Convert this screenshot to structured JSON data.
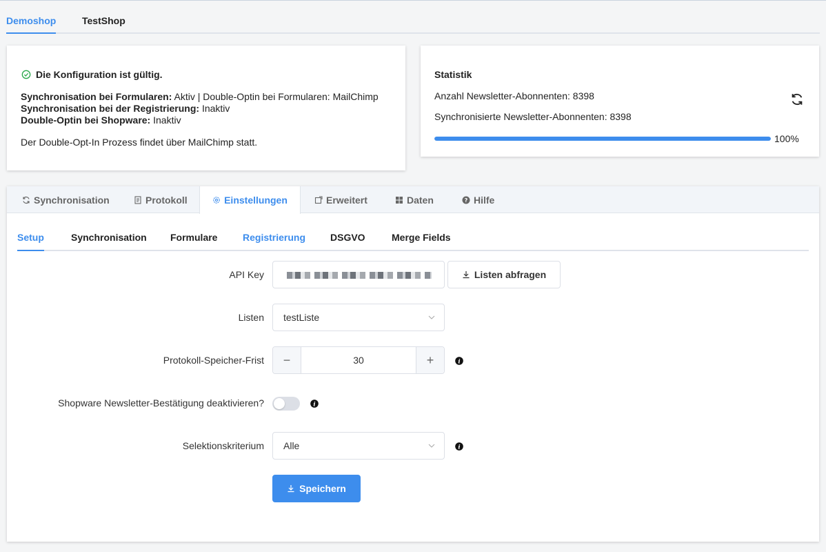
{
  "shop_tabs": [
    {
      "label": "Demoshop",
      "active": true
    },
    {
      "label": "TestShop",
      "active": false
    }
  ],
  "config": {
    "valid_text": "Die Konfiguration ist gültig.",
    "form_sync_label": "Synchronisation bei Formularen:",
    "form_sync_value": "Aktiv | Double-Optin bei Formularen: MailChimp",
    "reg_sync_label": "Synchronisation bei der Registrierung:",
    "reg_sync_value": "Inaktiv",
    "doi_label": "Double-Optin bei Shopware:",
    "doi_value": "Inaktiv",
    "note": "Der Double-Opt-In Prozess findet über MailChimp statt."
  },
  "stats": {
    "title": "Statistik",
    "subscribers": "Anzahl Newsletter-Abonnenten: 8398",
    "synced": "Synchronisierte Newsletter-Abonnenten: 8398",
    "progress_percent": 100,
    "progress_text": "100%"
  },
  "main_tabs": [
    {
      "label": "Synchronisation",
      "icon": "sync-icon"
    },
    {
      "label": "Protokoll",
      "icon": "document-icon"
    },
    {
      "label": "Einstellungen",
      "icon": "gear-icon",
      "active": true
    },
    {
      "label": "Erweitert",
      "icon": "external-icon"
    },
    {
      "label": "Daten",
      "icon": "grid-icon"
    },
    {
      "label": "Hilfe",
      "icon": "question-icon"
    }
  ],
  "sub_tabs": [
    {
      "label": "Setup",
      "active": true
    },
    {
      "label": "Synchronisation"
    },
    {
      "label": "Formulare"
    },
    {
      "label": "Registrierung"
    },
    {
      "label": "DSGVO"
    },
    {
      "label": "Merge Fields"
    }
  ],
  "form": {
    "api_key_label": "API Key",
    "fetch_lists_button": "Listen abfragen",
    "lists_label": "Listen",
    "lists_value": "testListe",
    "log_retention_label": "Protokoll-Speicher-Frist",
    "log_retention_value": "30",
    "disable_confirmation_label": "Shopware Newsletter-Bestätigung deaktivieren?",
    "disable_confirmation_on": false,
    "selection_label": "Selektionskriterium",
    "selection_value": "Alle",
    "save_button": "Speichern"
  },
  "colors": {
    "accent": "#3d8ded",
    "success": "#2aa84a"
  }
}
